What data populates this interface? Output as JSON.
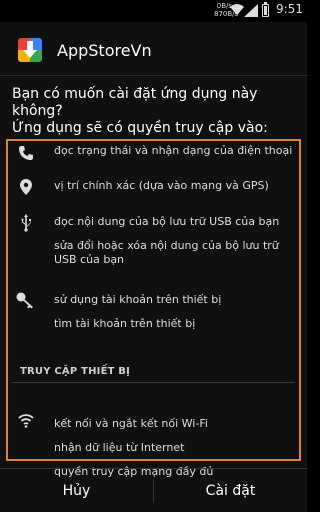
{
  "status_bar": {
    "net_up": "0B/s",
    "net_down": "870B/s",
    "time": "9:51"
  },
  "dialog": {
    "app_name": "AppStoreVn",
    "question_line1": "Bạn có muốn cài đặt ứng dụng này không?",
    "question_line2": "Ứng dụng sẽ có quyền truy cập vào:",
    "permissions": [
      {
        "icon": "phone-icon",
        "lines": [
          "đọc trạng thái và nhận dạng của điện thoại"
        ]
      },
      {
        "icon": "location-pin-icon",
        "lines": [
          "vị trí chính xác (dựa vào mạng và GPS)"
        ]
      },
      {
        "icon": "usb-icon",
        "lines": [
          "đọc nội dung của bộ lưu trữ USB của bạn",
          "sửa đổi hoặc xóa nội dung của bộ lưu trữ USB của bạn"
        ]
      },
      {
        "icon": "key-icon",
        "lines": [
          "sử dụng tài khoản trên thiết bị",
          "tìm tài khoản trên thiết bị"
        ]
      }
    ],
    "section_device": "TRUY CẬP THIẾT BỊ",
    "device_permissions": [
      {
        "icon": "wifi-icon",
        "lines": [
          "kết nối và ngắt kết nối Wi-Fi",
          "nhận dữ liệu từ Internet",
          "quyền truy cập mạng đầy đủ"
        ]
      }
    ],
    "cancel_label": "Hủy",
    "install_label": "Cài đặt",
    "accent_color": "#e2812d"
  }
}
